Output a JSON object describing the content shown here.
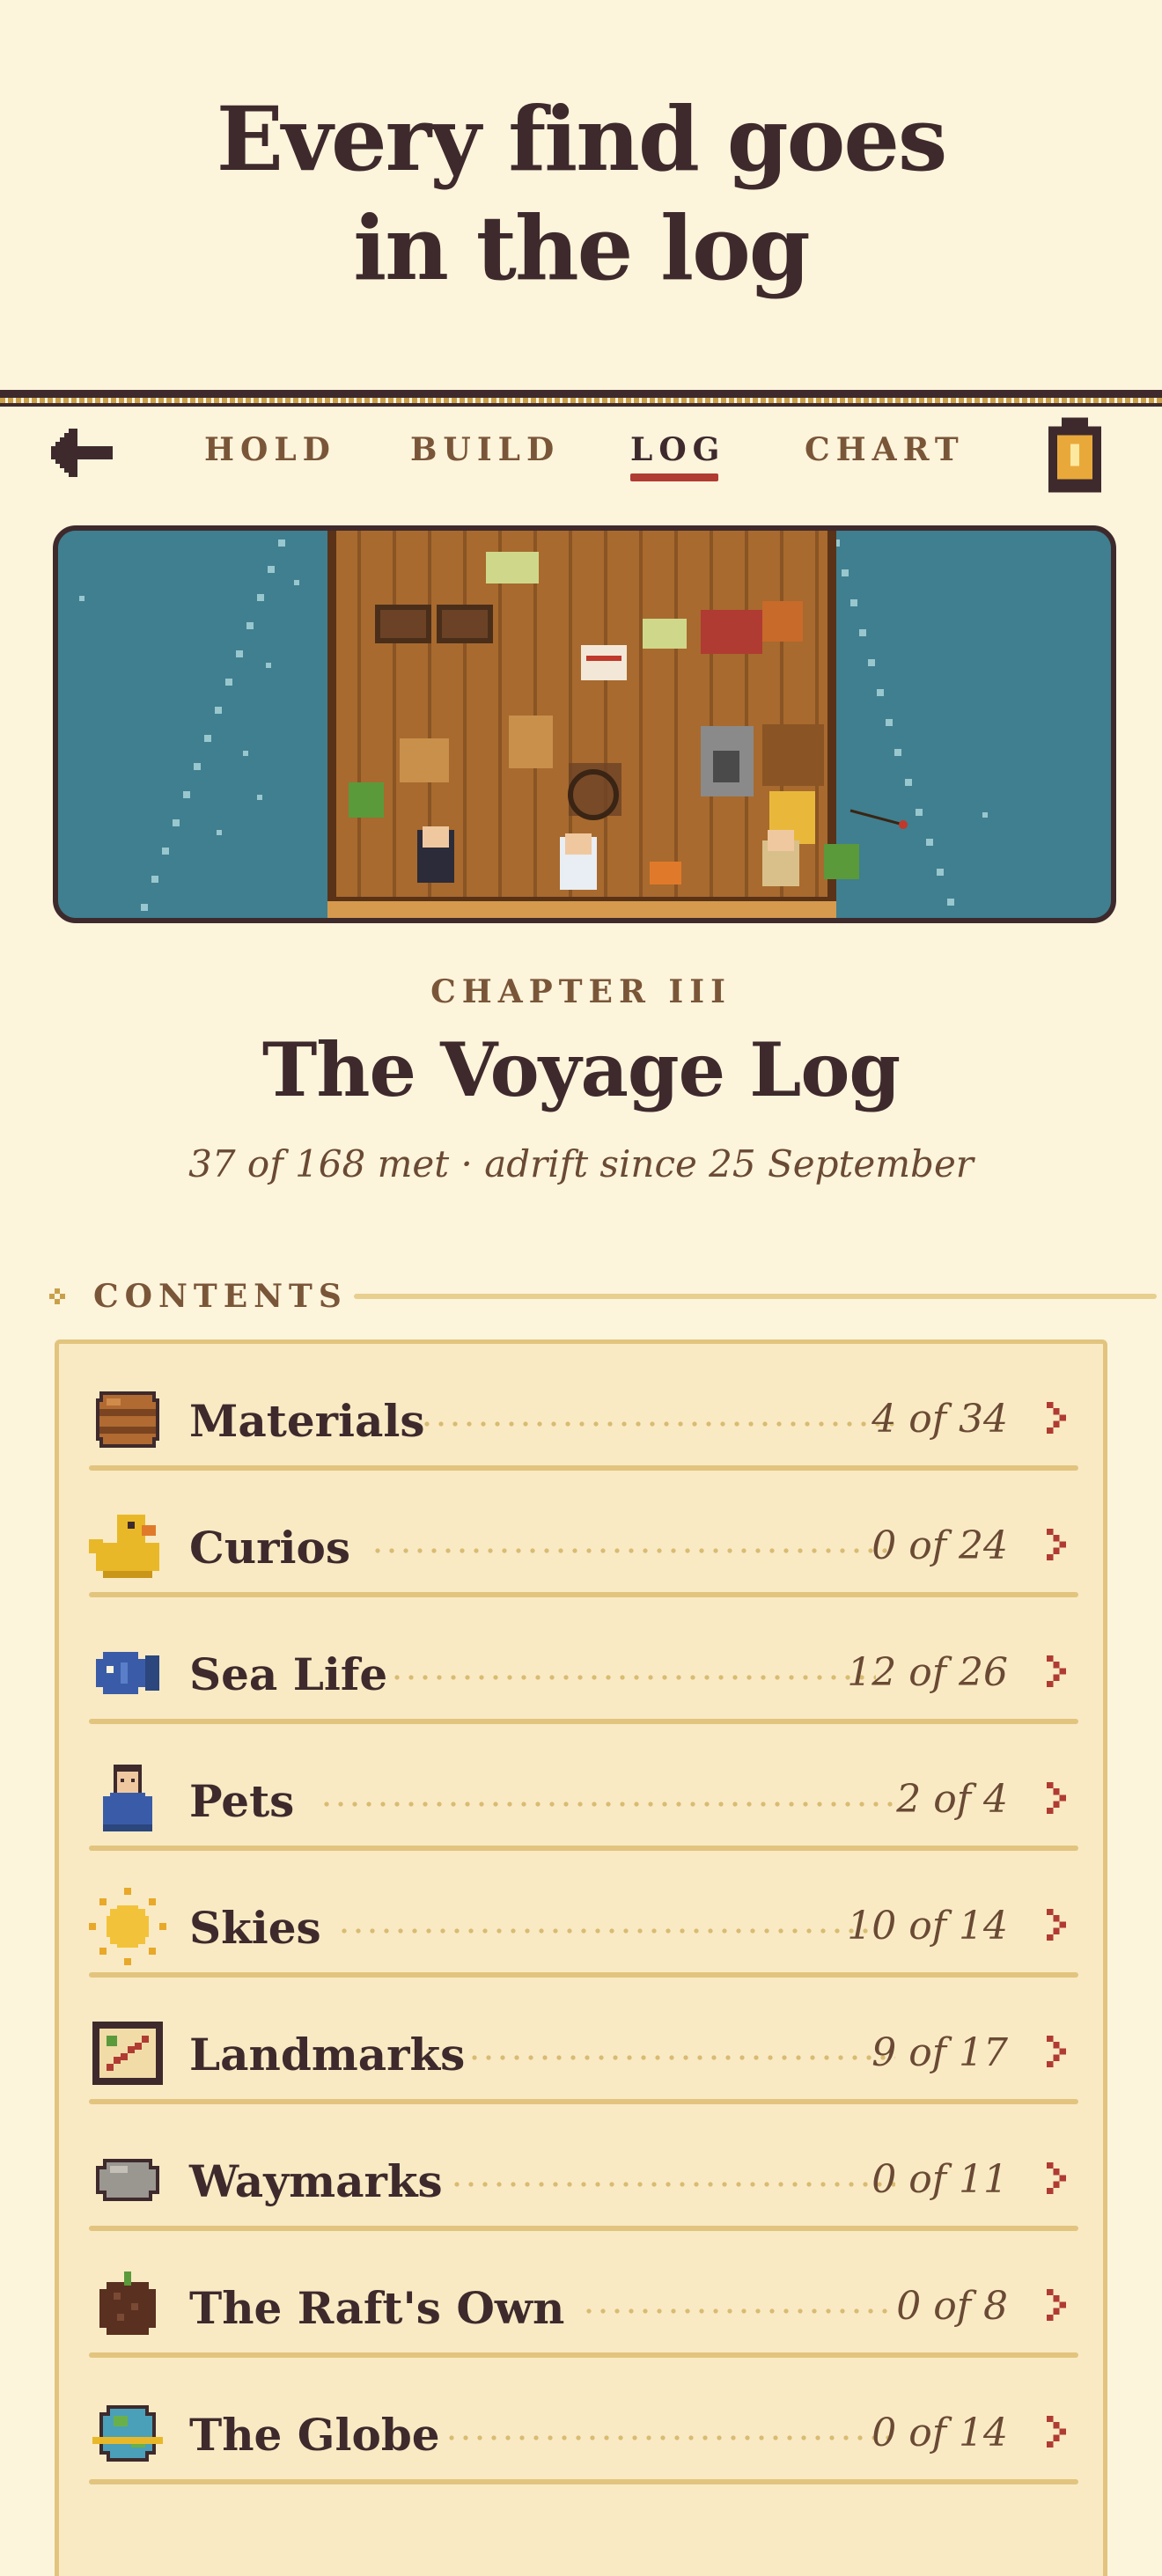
{
  "hero": {
    "headline_line1": "Every find goes",
    "headline_line2": "in the log"
  },
  "nav": {
    "tabs": [
      {
        "label": "HOLD",
        "active": false
      },
      {
        "label": "BUILD",
        "active": false
      },
      {
        "label": "LOG",
        "active": true
      },
      {
        "label": "CHART",
        "active": false
      }
    ],
    "back_icon": "arrow-left-icon",
    "right_icon": "lantern-icon"
  },
  "banner": {
    "image": "pixel-art raft on sea"
  },
  "header": {
    "chapter": "CHAPTER III",
    "title": "The Voyage Log",
    "subtitle": "37 of 168 met · adrift since 25 September"
  },
  "contents": {
    "label": "CONTENTS",
    "items": [
      {
        "label": "Materials",
        "count": "4 of 34",
        "icon": "barrel-icon"
      },
      {
        "label": "Curios",
        "count": "0 of 24",
        "icon": "rubber-duck-icon"
      },
      {
        "label": "Sea Life",
        "count": "12 of 26",
        "icon": "fish-icon"
      },
      {
        "label": "Pets",
        "count": "2 of 4",
        "icon": "penguin-icon"
      },
      {
        "label": "Skies",
        "count": "10 of 14",
        "icon": "sun-icon"
      },
      {
        "label": "Landmarks",
        "count": "9 of 17",
        "icon": "map-icon"
      },
      {
        "label": "Waymarks",
        "count": "0 of 11",
        "icon": "stone-icon"
      },
      {
        "label": "The Raft's Own",
        "count": "0 of 8",
        "icon": "coconut-icon"
      },
      {
        "label": "The Globe",
        "count": "0 of 14",
        "icon": "globe-icon"
      }
    ]
  },
  "colors": {
    "background": "#fdf4dc",
    "ink": "#3e2a2c",
    "accent_underline": "#b03b32",
    "sea": "#3f7f8f",
    "panel": "#f9eac4",
    "panel_border": "#e2c47e"
  }
}
